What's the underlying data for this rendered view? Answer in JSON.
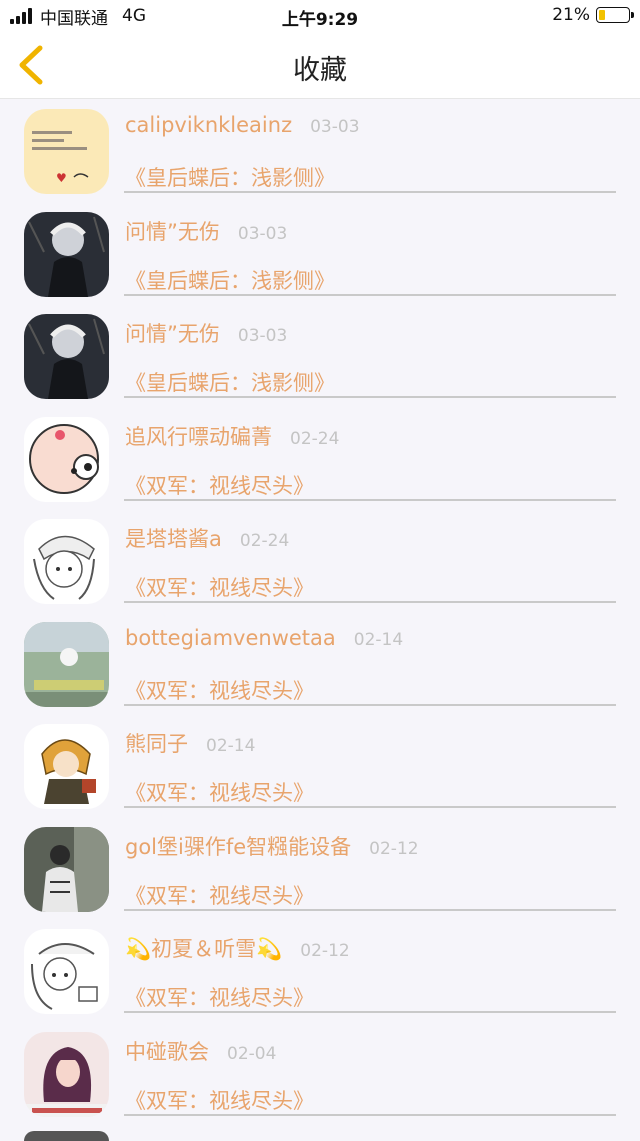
{
  "status": {
    "carrier": "中国联通",
    "network": "4G",
    "time": "上午9:29",
    "battery_text": "21%",
    "battery_level": 0.21
  },
  "nav": {
    "title": "收藏",
    "back_icon": "chevron-left-icon",
    "accent_color": "#f0b400"
  },
  "items": [
    {
      "name": "calipviknkleainz",
      "date": "03-03",
      "book": "《皇后蝶后：浅影侧》"
    },
    {
      "name": "问情”无伤",
      "date": "03-03",
      "book": "《皇后蝶后：浅影侧》"
    },
    {
      "name": "问情”无伤",
      "date": "03-03",
      "book": "《皇后蝶后：浅影侧》"
    },
    {
      "name": "追风行嘌动碥菁",
      "date": "02-24",
      "book": "《双军：视线尽头》"
    },
    {
      "name": "是塔塔酱a",
      "date": "02-24",
      "book": "《双军：视线尽头》"
    },
    {
      "name": "bottegiamvenwetaa",
      "date": "02-14",
      "book": "《双军：视线尽头》"
    },
    {
      "name": "熊同子",
      "date": "02-14",
      "book": "《双军：视线尽头》"
    },
    {
      "name": "gol堡i骒作fe智糨能设备",
      "date": "02-12",
      "book": "《双军：视线尽头》"
    },
    {
      "name": "💫初夏＆听雪💫",
      "date": "02-12",
      "book": "《双军：视线尽头》"
    },
    {
      "name": "中碰歌会",
      "date": "02-04",
      "book": "《双军：视线尽头》"
    }
  ]
}
